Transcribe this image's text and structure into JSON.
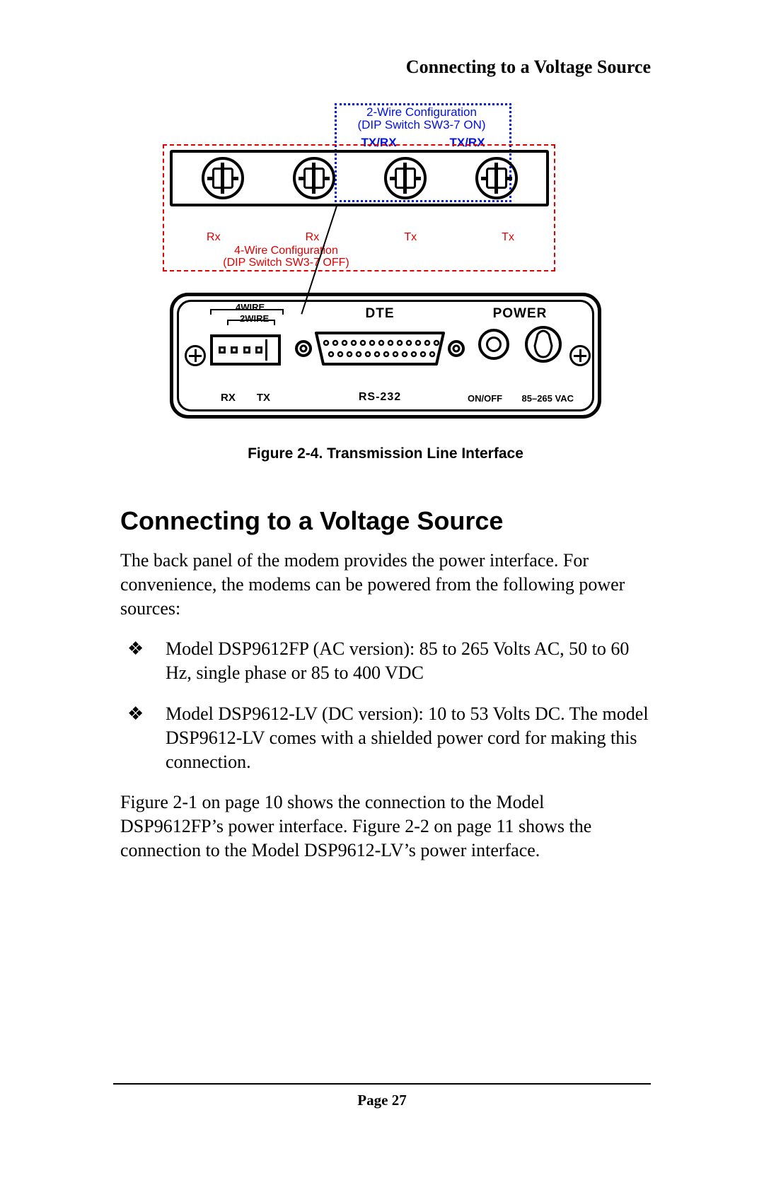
{
  "header": {
    "running_title": "Connecting to a Voltage Source"
  },
  "figure": {
    "blue_box": {
      "title_line1": "2-Wire Configuration",
      "title_line2": "(DIP Switch SW3-7 ON)",
      "txrx_left": "TX/RX",
      "txrx_right": "TX/RX"
    },
    "red_box": {
      "labels": [
        "Rx",
        "Rx",
        "Tx",
        "Tx"
      ],
      "title_line1": "4-Wire Configuration",
      "title_line2": "(DIP Switch SW3-7 OFF)"
    },
    "device": {
      "line": {
        "label_4wire": "4WIRE",
        "label_2wire": "2WIRE",
        "rx": "RX",
        "tx": "TX"
      },
      "rs232": {
        "top_label": "DTE",
        "bottom_label": "RS-232"
      },
      "power": {
        "top_label": "POWER",
        "onoff_label": "ON/OFF",
        "ac_label": "85–265 VAC"
      }
    },
    "caption": "Figure 2-4. Transmission Line Interface"
  },
  "section": {
    "heading": "Connecting to a Voltage Source",
    "para1": "The back panel of the modem provides the power interface. For convenience, the modems can be powered from the following power sources:",
    "bullets": [
      "Model DSP9612FP (AC version): 85 to 265 Volts AC, 50 to 60 Hz, single phase or 85 to 400 VDC",
      "Model DSP9612-LV (DC version): 10 to 53 Volts DC. The model DSP9612-LV  comes with a shielded power cord for making this connection."
    ],
    "para2": "Figure 2-1 on page 10 shows the connection to the Model DSP9612FP’s power interface. Figure 2-2 on page 11 shows the connection to the Model DSP9612-LV’s power interface."
  },
  "footer": {
    "page_label": "Page 27"
  },
  "glyphs": {
    "bullet": "❖"
  }
}
